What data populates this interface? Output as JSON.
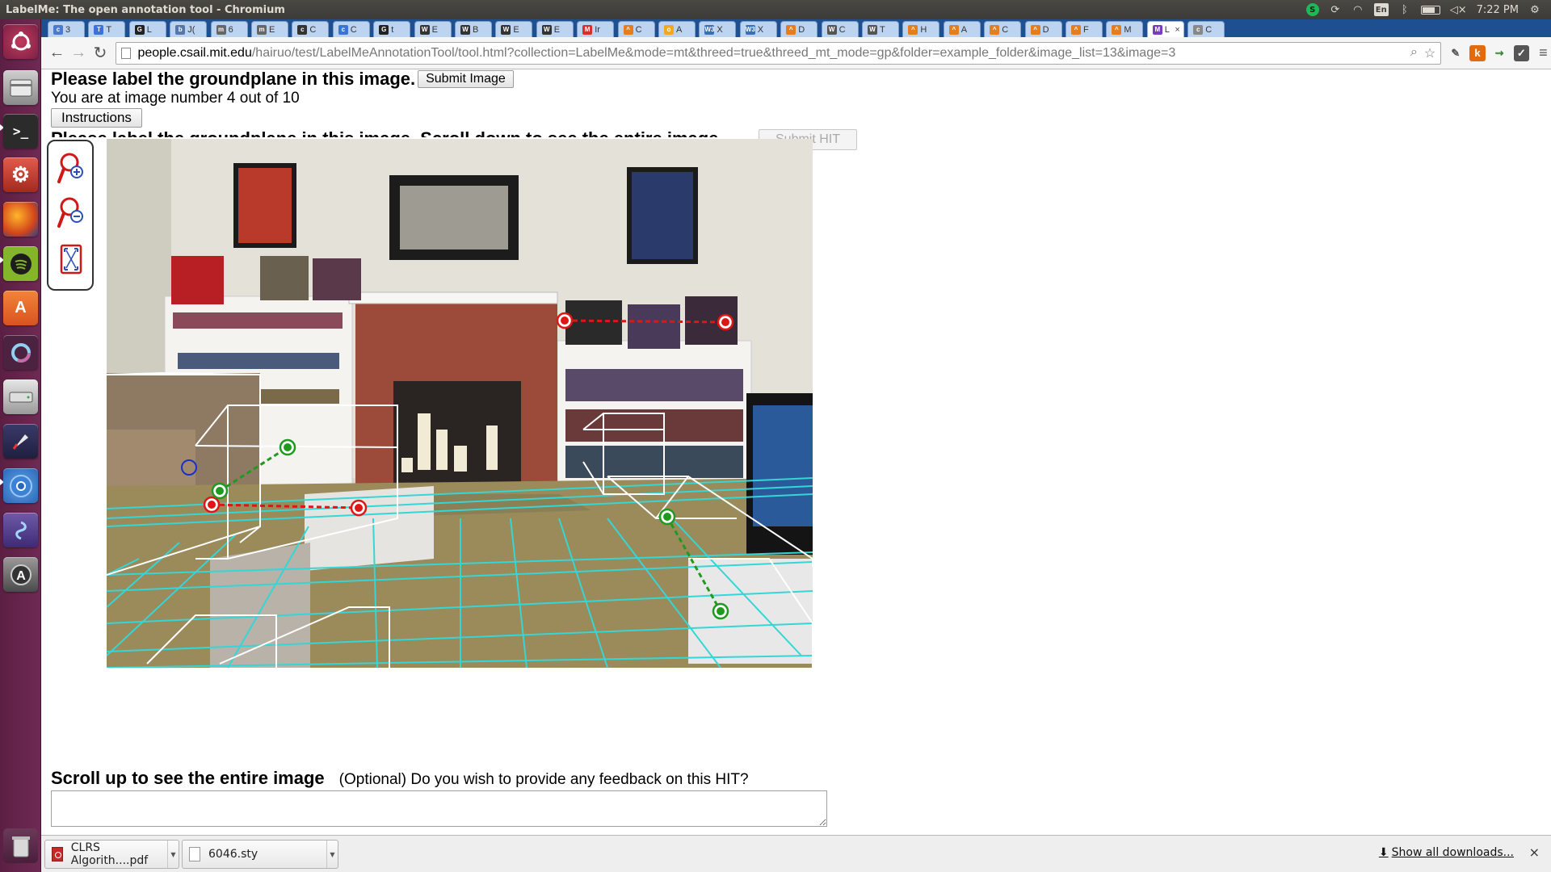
{
  "window": {
    "title": "LabelMe: The open annotation tool - Chromium",
    "clock": "7:22 PM",
    "keyboard_layout": "En"
  },
  "tabs": [
    {
      "label": "3",
      "icon": "c",
      "color": "#4a7bd0"
    },
    {
      "label": "T",
      "icon": "T",
      "color": "#3b73d9"
    },
    {
      "label": "L",
      "icon": "G",
      "color": "#222222"
    },
    {
      "label": "J(",
      "icon": "b",
      "color": "#5577aa"
    },
    {
      "label": "6",
      "icon": "m",
      "color": "#666666"
    },
    {
      "label": "E",
      "icon": "m",
      "color": "#666666"
    },
    {
      "label": "C",
      "icon": "c",
      "color": "#333333"
    },
    {
      "label": "C",
      "icon": "c",
      "color": "#3b73d9"
    },
    {
      "label": "t",
      "icon": "G",
      "color": "#222222"
    },
    {
      "label": "E",
      "icon": "W",
      "color": "#333333"
    },
    {
      "label": "B",
      "icon": "W",
      "color": "#333333"
    },
    {
      "label": "E",
      "icon": "W",
      "color": "#333333"
    },
    {
      "label": "E",
      "icon": "W",
      "color": "#333333"
    },
    {
      "label": "Ir",
      "icon": "M",
      "color": "#d93025"
    },
    {
      "label": "C",
      "icon": "^",
      "color": "#e37d1f"
    },
    {
      "label": "A",
      "icon": "o",
      "color": "#f2a81d"
    },
    {
      "label": "X",
      "icon": "W3",
      "color": "#3d6fb3"
    },
    {
      "label": "X",
      "icon": "W3",
      "color": "#3d6fb3"
    },
    {
      "label": "D",
      "icon": "^",
      "color": "#e37d1f"
    },
    {
      "label": "C",
      "icon": "W",
      "color": "#555555"
    },
    {
      "label": "T",
      "icon": "W",
      "color": "#555555"
    },
    {
      "label": "H",
      "icon": "^",
      "color": "#e37d1f"
    },
    {
      "label": "A",
      "icon": "^",
      "color": "#e37d1f"
    },
    {
      "label": "C",
      "icon": "^",
      "color": "#e37d1f"
    },
    {
      "label": "D",
      "icon": "^",
      "color": "#e37d1f"
    },
    {
      "label": "F",
      "icon": "^",
      "color": "#e37d1f"
    },
    {
      "label": "M",
      "icon": "^",
      "color": "#e37d1f"
    },
    {
      "label": "L",
      "icon": "M",
      "color": "#7a3cbc",
      "active": true
    },
    {
      "label": "C",
      "icon": "c",
      "color": "#888888"
    }
  ],
  "address_bar": {
    "host": "people.csail.mit.edu",
    "path": "/hairuo/test/LabelMeAnnotationTool/tool.html?collection=LabelMe&mode=mt&threed=true&threed_mt_mode=gp&folder=example_folder&image_list=13&image=3"
  },
  "page": {
    "heading": "Please label the groundplane in this image.",
    "submit_image_label": "Submit Image",
    "progress_text": "You are at image number 4 out of 10",
    "instructions_label": "Instructions",
    "subheading": "Please label the groundplane in this image. Scroll down to see the entire image.",
    "submit_hit_label": "Submit HIT",
    "scroll_up_text": "Scroll up to see the entire image",
    "feedback_question": "(Optional) Do you wish to provide any feedback on this HIT?",
    "feedback_value": ""
  },
  "zoom_tools": [
    {
      "name": "zoom-in-icon"
    },
    {
      "name": "zoom-out-icon"
    },
    {
      "name": "fit-image-icon"
    }
  ],
  "downloads": [
    {
      "name": "CLRS Algorith....pdf",
      "type": "pdf"
    },
    {
      "name": "6046.sty",
      "type": "file"
    }
  ],
  "show_all_label": "Show all downloads...",
  "colors": {
    "groundplane_grid": "#34d6d6",
    "handle_red": "#e01515",
    "handle_green": "#1f9a1f",
    "handle_blue": "#1a2fcc",
    "cuboid": "#ffffff"
  }
}
